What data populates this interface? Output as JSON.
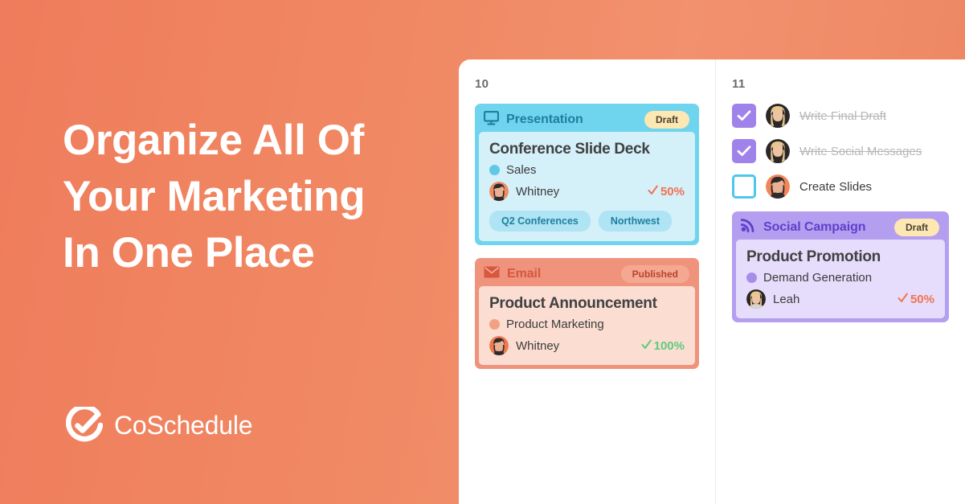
{
  "hero": {
    "headline_lines": [
      "Organize All Of",
      "Your Marketing",
      "In One Place"
    ],
    "brand_name": "CoSchedule",
    "brand_icon": "coschedule-check-circle-logo"
  },
  "colors": {
    "background_start": "#ef7c5c",
    "background_end": "#ec8361",
    "panel": "#ffffff",
    "presentation": "#6fd4ee",
    "presentation_body": "#d4f0f9",
    "email": "#ef937c",
    "email_body": "#fbddd2",
    "social": "#b49ef0",
    "social_body": "#e5ddfb",
    "draft_pill": "#fde7b2",
    "checkbox_checked": "#a083ea",
    "checkbox_unchecked_border": "#4cc8ec",
    "pct_orange": "#f2724f",
    "pct_green": "#5ecb7f"
  },
  "calendar": {
    "columns": [
      {
        "day": "10",
        "cards": [
          {
            "type_label": "Presentation",
            "type_icon": "presentation-monitor-icon",
            "status_label": "Draft",
            "title": "Conference Slide Deck",
            "project": "Sales",
            "owner": "Whitney",
            "owner_avatar": "avatar-dark-hair-woman",
            "progress": "50%",
            "progress_icon": "check-icon",
            "tags": [
              "Q2 Conferences",
              "Northwest"
            ]
          },
          {
            "type_label": "Email",
            "type_icon": "envelope-icon",
            "status_label": "Published",
            "title": "Product Announcement",
            "project": "Product Marketing",
            "owner": "Whitney",
            "owner_avatar": "avatar-dark-hair-woman",
            "progress": "100%",
            "progress_icon": "check-icon",
            "tags": []
          }
        ],
        "tasks": []
      },
      {
        "day": "11",
        "tasks": [
          {
            "label": "Write Final Draft",
            "checked": true,
            "avatar": "avatar-blonde-woman"
          },
          {
            "label": "Write Social Messages",
            "checked": true,
            "avatar": "avatar-blonde-woman"
          },
          {
            "label": "Create Slides",
            "checked": false,
            "avatar": "avatar-dark-hair-woman"
          }
        ],
        "cards": [
          {
            "type_label": "Social Campaign",
            "type_icon": "rss-broadcast-icon",
            "status_label": "Draft",
            "title": "Product Promotion",
            "project": "Demand Generation",
            "owner": "Leah",
            "owner_avatar": "avatar-blonde-woman",
            "progress": "50%",
            "progress_icon": "check-icon",
            "tags": []
          }
        ]
      }
    ]
  }
}
